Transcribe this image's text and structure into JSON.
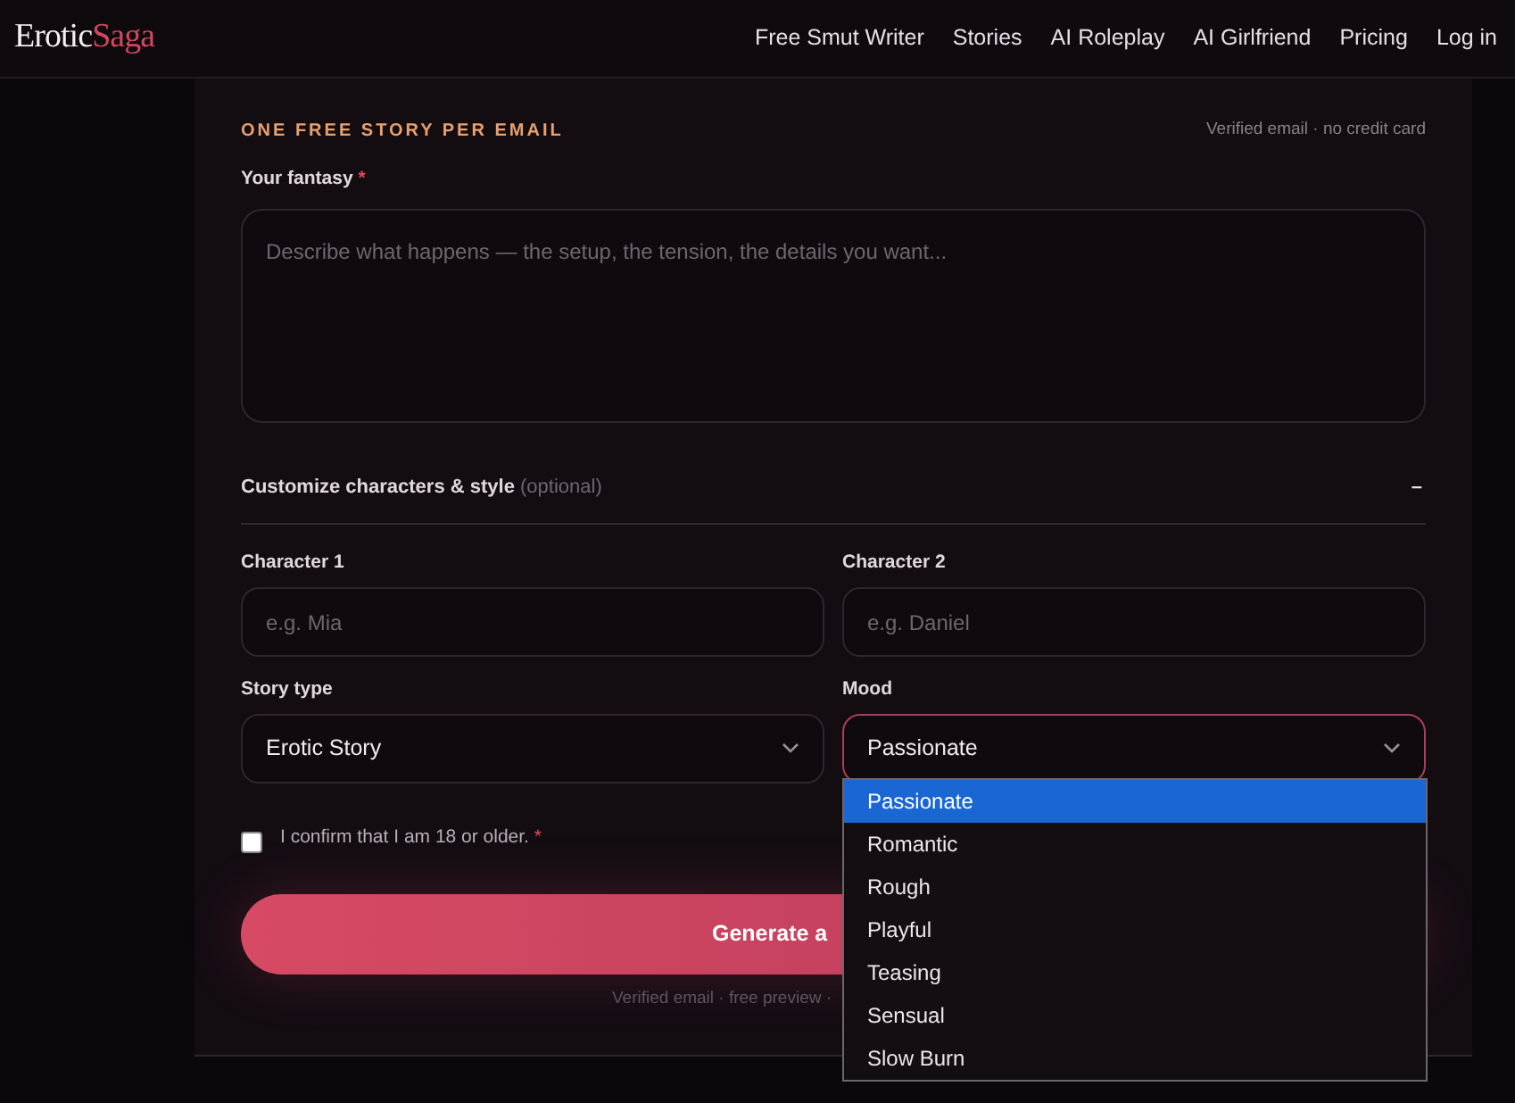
{
  "header": {
    "logo": {
      "first": "Erotic",
      "second": "Saga"
    },
    "nav": [
      "Free Smut Writer",
      "Stories",
      "AI Roleplay",
      "AI Girlfriend",
      "Pricing",
      "Log in"
    ]
  },
  "form": {
    "eyebrow": "ONE FREE STORY PER EMAIL",
    "note": "Verified email · no credit card",
    "fantasy": {
      "label": "Your fantasy",
      "required": "*",
      "placeholder": "Describe what happens — the setup, the tension, the details you want..."
    },
    "customize": {
      "title": "Customize characters & style",
      "hint": "(optional)",
      "toggle": "–",
      "expanded": true
    },
    "character_1": {
      "label": "Character 1",
      "placeholder": "e.g. Mia"
    },
    "character_2": {
      "label": "Character 2",
      "placeholder": "e.g. Daniel"
    },
    "story_type": {
      "label": "Story type",
      "value": "Erotic Story"
    },
    "mood": {
      "label": "Mood",
      "value": "Passionate",
      "options": [
        {
          "label": "Passionate",
          "selected": true
        },
        {
          "label": "Romantic",
          "selected": false
        },
        {
          "label": "Rough",
          "selected": false
        },
        {
          "label": "Playful",
          "selected": false
        },
        {
          "label": "Teasing",
          "selected": false
        },
        {
          "label": "Sensual",
          "selected": false
        },
        {
          "label": "Slow Burn",
          "selected": false
        }
      ]
    },
    "confirm": {
      "label": "I confirm that I am 18 or older.",
      "required": "*",
      "checked": false
    },
    "submit": "Generate a",
    "footnote": "Verified email · free preview ·"
  }
}
